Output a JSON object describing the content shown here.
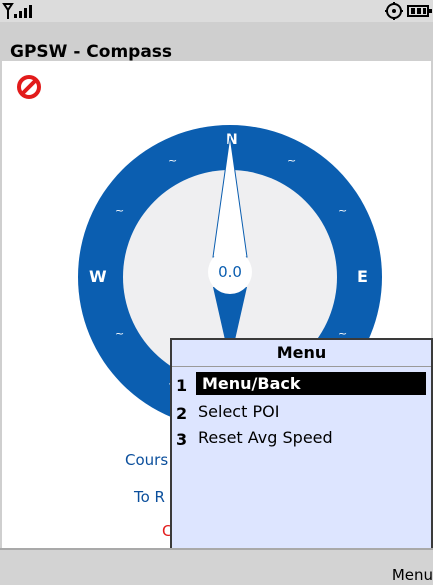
{
  "app": {
    "title": "GPSW - Compass"
  },
  "status_bar": {
    "signal_icon": "signal-icon",
    "bt_icon": "bluetooth-icon",
    "battery_icon": "battery-icon"
  },
  "compass": {
    "speed": "0.0",
    "directions": {
      "n": "N",
      "e": "E",
      "w": "W"
    },
    "colors": {
      "ring": "#0b5eb0",
      "face": "#efeff1",
      "needle": "#0b5eb0",
      "needle_tip": "#ffffff"
    }
  },
  "info_lines": [
    {
      "label": "Cours",
      "color": "#0b4f9c"
    },
    {
      "label": "To R",
      "color": "#0b4f9c"
    },
    {
      "label": "C",
      "color": "#e21b1b"
    }
  ],
  "menu": {
    "title": "Menu",
    "items": [
      {
        "num": "1",
        "label": "Menu/Back",
        "selected": true
      },
      {
        "num": "2",
        "label": "Select POI",
        "selected": false
      },
      {
        "num": "3",
        "label": "Reset Avg Speed",
        "selected": false
      }
    ]
  },
  "softkeys": {
    "right": "Menu"
  }
}
